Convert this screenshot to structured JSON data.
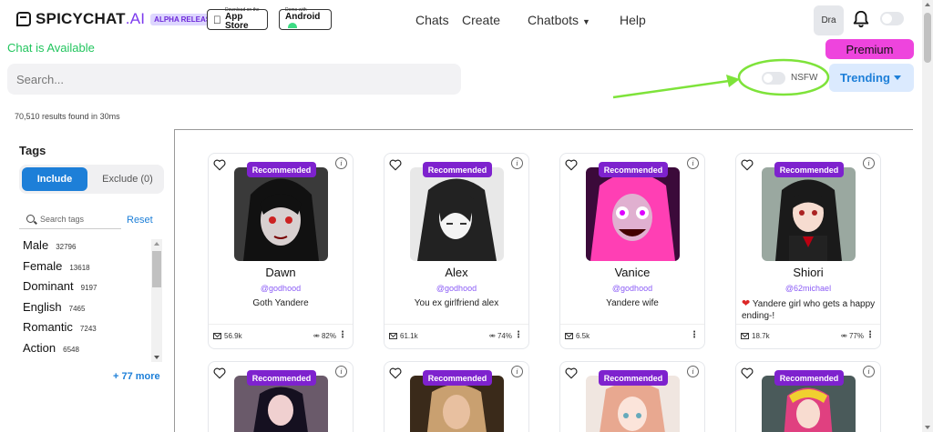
{
  "header": {
    "logo_main": "SPICYCHAT",
    "logo_ai": ".AI",
    "alpha_badge": "ALPHA RELEASE",
    "app_store_small": "Download on the",
    "app_store_big": "App Store",
    "android_small": "Demo with",
    "android_big": "Android",
    "nav": {
      "chats": "Chats",
      "create": "Create",
      "chatbots": "Chatbots",
      "help": "Help"
    },
    "avatar_text": "Dra"
  },
  "status_text": "Chat is Available",
  "premium_label": "Premium",
  "search": {
    "placeholder": "Search..."
  },
  "nsfw_label": "NSFW",
  "trending_label": "Trending",
  "results_text": "70,510 results found in 30ms",
  "sidebar": {
    "title": "Tags",
    "include_label": "Include",
    "exclude_label": "Exclude (0)",
    "tag_search_placeholder": "Search tags",
    "reset_label": "Reset",
    "tags": [
      {
        "name": "Male",
        "count": "32796"
      },
      {
        "name": "Female",
        "count": "13618"
      },
      {
        "name": "Dominant",
        "count": "9197"
      },
      {
        "name": "English",
        "count": "7465"
      },
      {
        "name": "Romantic",
        "count": "7243"
      },
      {
        "name": "Action",
        "count": "6548"
      }
    ],
    "more_label": "+ 77 more"
  },
  "cards": [
    {
      "badge": "Recommended",
      "name": "Dawn",
      "handle": "@godhood",
      "desc": "Goth Yandere",
      "messages": "56.9k",
      "rating": "82%"
    },
    {
      "badge": "Recommended",
      "name": "Alex",
      "handle": "@godhood",
      "desc": "You ex girlfriend alex",
      "messages": "61.1k",
      "rating": "74%"
    },
    {
      "badge": "Recommended",
      "name": "Vanice",
      "handle": "@godhood",
      "desc": "Yandere wife",
      "messages": "6.5k",
      "rating": ""
    },
    {
      "badge": "Recommended",
      "name": "Shiori",
      "handle": "@62michael",
      "desc": "Yandere girl who gets a happy ending-!",
      "messages": "18.7k",
      "rating": "77%"
    }
  ],
  "cards_row2": [
    {
      "badge": "Recommended"
    },
    {
      "badge": "Recommended"
    },
    {
      "badge": "Recommended"
    },
    {
      "badge": "Recommended"
    }
  ],
  "colors": {
    "accent_blue": "#1d7fd8",
    "badge_purple": "#7e22ce",
    "premium_pink": "#ee44dd",
    "available_green": "#22c55e",
    "annotation_green": "#7ee33a"
  }
}
